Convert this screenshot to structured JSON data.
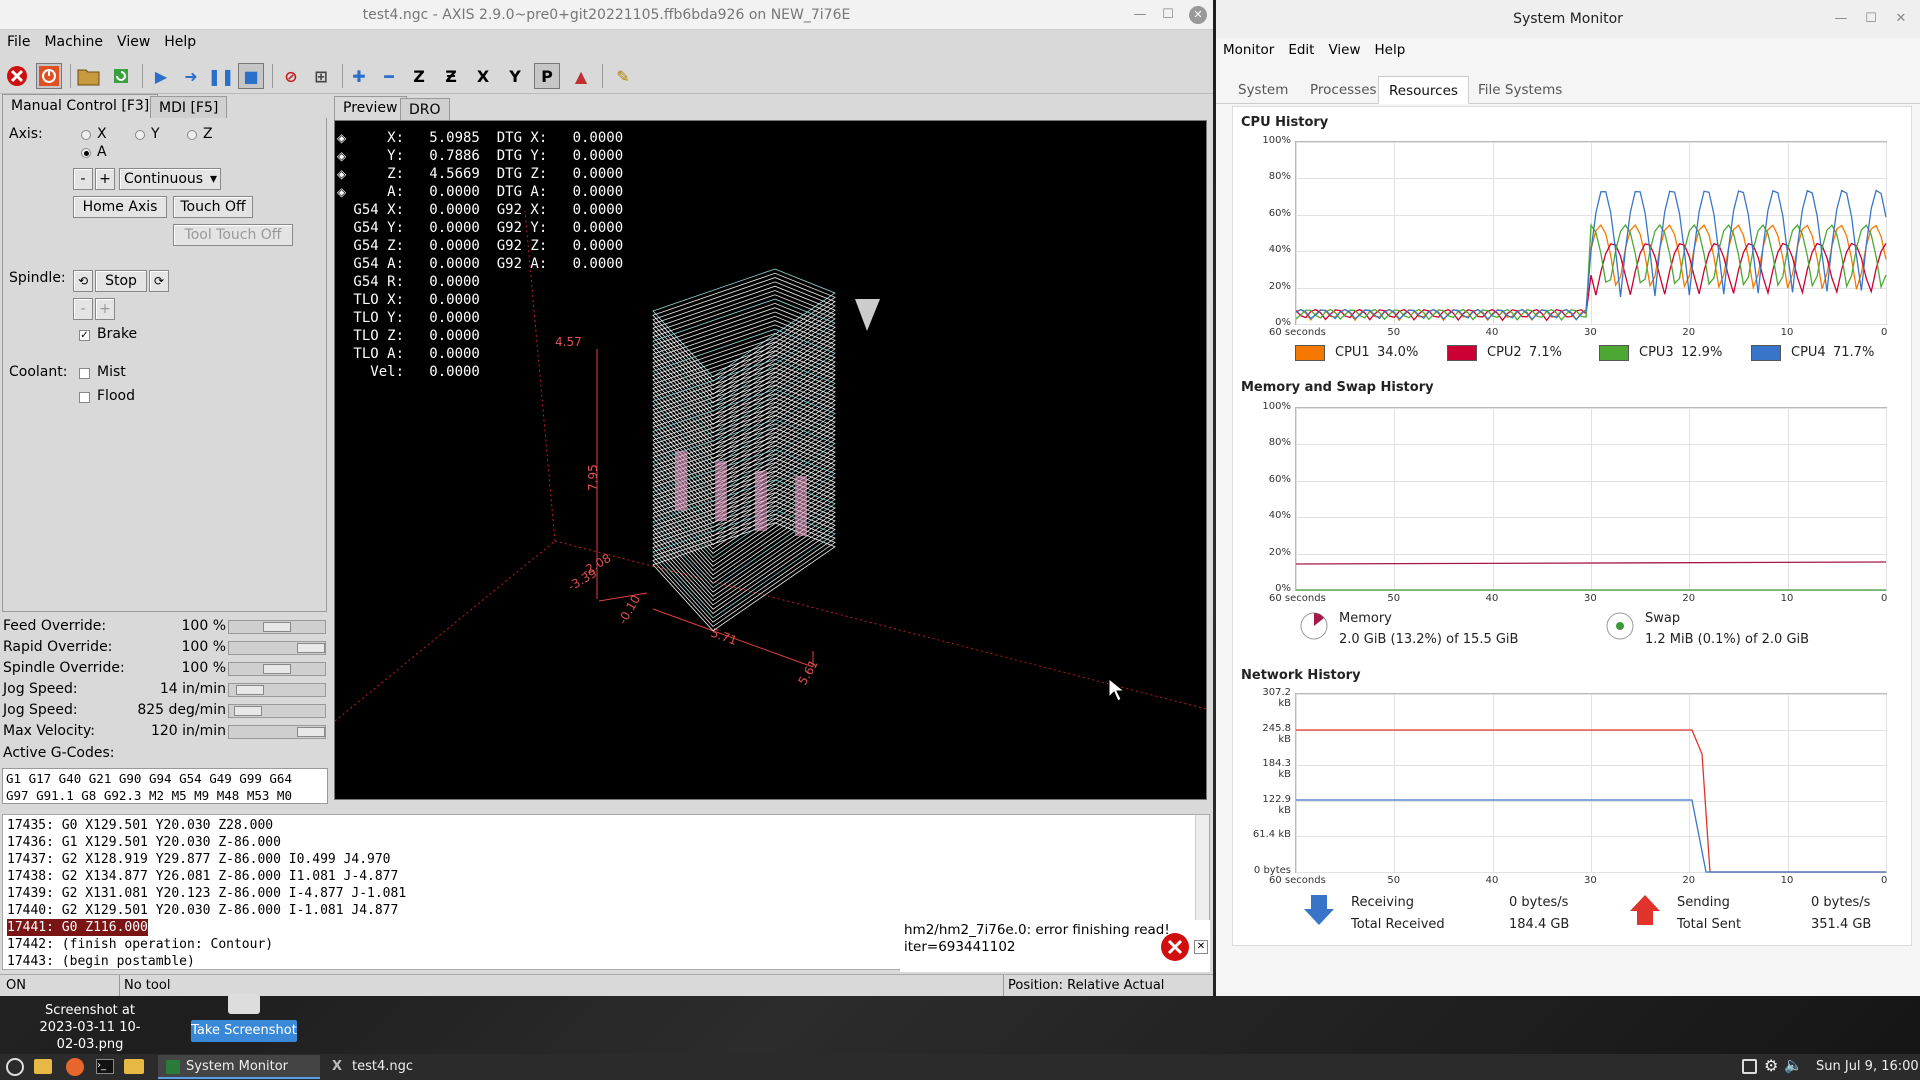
{
  "axis": {
    "title": "test4.ngc - AXIS 2.9.0~pre0+git20221105.ffb6bda926 on NEW_7i76E",
    "menu": [
      "File",
      "Machine",
      "View",
      "Help"
    ],
    "tabs": {
      "manual": "Manual Control [F3]",
      "mdi": "MDI [F5]"
    },
    "preview_tabs": {
      "preview": "Preview",
      "dro": "DRO"
    },
    "axis_label": "Axis:",
    "axes": [
      "X",
      "Y",
      "Z",
      "A"
    ],
    "selected_axis": "A",
    "jog": {
      "minus": "-",
      "plus": "+",
      "increment": "Continuous"
    },
    "home_axis": "Home Axis",
    "touch_off": "Touch Off",
    "tool_touch_off": "Tool Touch Off",
    "spindle_label": "Spindle:",
    "spindle_stop": "Stop",
    "spindle_minus": "-",
    "spindle_plus": "+",
    "brake": "Brake",
    "coolant_label": "Coolant:",
    "mist": "Mist",
    "flood": "Flood",
    "overrides": [
      {
        "label": "Feed Override:",
        "value": "100 %",
        "level": 0.5
      },
      {
        "label": "Rapid Override:",
        "value": "100 %",
        "level": 1.0
      },
      {
        "label": "Spindle Override:",
        "value": "100 %",
        "level": 0.5
      },
      {
        "label": "Jog Speed:",
        "value": "14 in/min",
        "level": 0.1
      },
      {
        "label": "Jog Speed:",
        "value": "825 deg/min",
        "level": 0.08
      },
      {
        "label": "Max Velocity:",
        "value": "120 in/min",
        "level": 1.0
      }
    ],
    "active_gcodes_label": "Active G-Codes:",
    "active_gcodes_line1": "G1 G17 G40 G21 G90 G94 G54 G49 G99 G64",
    "active_gcodes_line2": "G97 G91.1 G8 G92.3 M2 M5 M9 M48 M53 M0",
    "dro": [
      "     X:   5.0985  DTG X:   0.0000",
      "     Y:   0.7886  DTG Y:   0.0000",
      "     Z:   4.5669  DTG Z:   0.0000",
      "     A:   0.0000  DTG A:   0.0000",
      " G54 X:   0.0000  G92 X:   0.0000",
      " G54 Y:   0.0000  G92 Y:   0.0000",
      " G54 Z:   0.0000  G92 Z:   0.0000",
      " G54 A:   0.0000  G92 A:   0.0000",
      " G54 R:   0.0000",
      " TLO X:   0.0000",
      " TLO Y:   0.0000",
      " TLO Z:   0.0000",
      " TLO A:   0.0000",
      "   Vel:   0.0000"
    ],
    "dims": {
      "z_top": "4.57",
      "z_len": "7.95",
      "y_lo": "-2.08",
      "y_lo2": "-3.39",
      "x_lo": "-0.10",
      "x_len": "5.71",
      "x_hi": "5.61"
    },
    "program": [
      "17435: G0 X129.501 Y20.030 Z28.000",
      "17436: G1 X129.501 Y20.030 Z-86.000",
      "17437: G2 X128.919 Y29.877 Z-86.000 I0.499 J4.970",
      "17438: G2 X134.877 Y26.081 Z-86.000 I1.081 J-4.877",
      "17439: G2 X131.081 Y20.123 Z-86.000 I-4.877 J-1.081",
      "17440: G2 X129.501 Y20.030 Z-86.000 I-1.081 J4.877",
      "17441: G0 Z116.000",
      "17442: (finish operation: Contour)",
      "17443: (begin postamble)"
    ],
    "highlight_line": 6,
    "error_line1": "hm2/hm2_7i76e.0: error finishing read!",
    "error_line2": "iter=693441102",
    "status": {
      "machine": "ON",
      "tool": "No tool",
      "position": "Position: Relative Actual"
    }
  },
  "sysmon": {
    "title": "System Monitor",
    "menu": [
      "Monitor",
      "Edit",
      "View",
      "Help"
    ],
    "tabs": [
      "System",
      "Processes",
      "Resources",
      "File Systems"
    ],
    "active_tab": "Resources",
    "cpu_title": "CPU History",
    "mem_title": "Memory and Swap History",
    "net_title": "Network History",
    "pct_labels": [
      "100%",
      "80%",
      "60%",
      "40%",
      "20%",
      "0%"
    ],
    "x_labels": [
      "60 seconds",
      "50",
      "40",
      "30",
      "20",
      "10",
      "0"
    ],
    "net_labels": [
      "307.2 kB",
      "245.8 kB",
      "184.3 kB",
      "122.9 kB",
      "61.4 kB",
      "0 bytes"
    ],
    "cpus": [
      {
        "label": "CPU1",
        "value": "34.0%",
        "color": "#f57900"
      },
      {
        "label": "CPU2",
        "value": "7.1%",
        "color": "#cc0033"
      },
      {
        "label": "CPU3",
        "value": "12.9%",
        "color": "#4ca832"
      },
      {
        "label": "CPU4",
        "value": "71.7%",
        "color": "#3875c9"
      }
    ],
    "memory": {
      "label": "Memory",
      "value": "2.0 GiB (13.2%) of 15.5 GiB",
      "color": "#a6184a"
    },
    "swap": {
      "label": "Swap",
      "value": "1.2 MiB (0.1%) of 2.0 GiB",
      "color": "#3a9a3a"
    },
    "receiving": {
      "label": "Receiving",
      "rate": "0 bytes/s",
      "total_label": "Total Received",
      "total": "184.4 GB",
      "color": "#3875c9"
    },
    "sending": {
      "label": "Sending",
      "rate": "0 bytes/s",
      "total_label": "Total Sent",
      "total": "351.4 GB",
      "color": "#e0332b"
    }
  },
  "desktop": {
    "screenshot_file": "Screenshot at 2023-03-11 10-02-03.png",
    "take_screenshot": "Take Screenshot",
    "tasks": [
      "System Monitor",
      "test4.ngc"
    ],
    "clock": "Sun Jul 9, 16:00"
  }
}
